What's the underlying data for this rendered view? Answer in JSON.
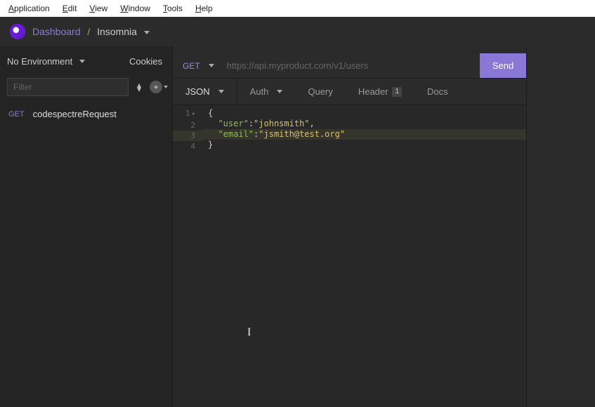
{
  "menu": {
    "items": [
      "Application",
      "Edit",
      "View",
      "Window",
      "Tools",
      "Help"
    ]
  },
  "breadcrumb": {
    "root": "Dashboard",
    "sep": "/",
    "current": "Insomnia"
  },
  "sidebar": {
    "no_env_label": "No Environment",
    "cookies_label": "Cookies",
    "filter_placeholder": "Filter",
    "requests": [
      {
        "method": "GET",
        "name": "codespectreRequest"
      }
    ]
  },
  "urlbar": {
    "method": "GET",
    "url_placeholder": "https://api.myproduct.com/v1/users",
    "send_label": "Send"
  },
  "tabs": {
    "body": "JSON",
    "auth": "Auth",
    "query": "Query",
    "header": "Header",
    "header_badge": "1",
    "docs": "Docs"
  },
  "editor": {
    "lines": [
      {
        "n": "1",
        "raw": "{"
      },
      {
        "n": "2",
        "raw": "  \"user\":\"johnsmith\","
      },
      {
        "n": "3",
        "raw": "  \"email\":\"jsmith@test.org\""
      },
      {
        "n": "4",
        "raw": "}"
      }
    ],
    "json_body": {
      "user": "johnsmith",
      "email": "jsmith@test.org"
    },
    "active_line": 3
  }
}
